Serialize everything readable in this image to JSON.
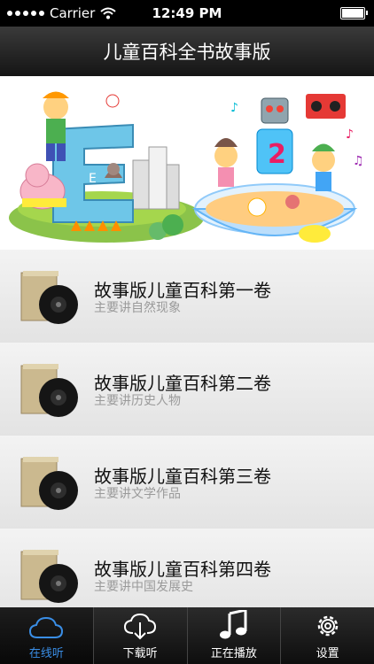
{
  "status_bar": {
    "carrier": "Carrier",
    "time": "12:49 PM"
  },
  "nav": {
    "title": "儿童百科全书故事版"
  },
  "banner": {
    "left_letter": "E",
    "right_numeral": "2"
  },
  "list": [
    {
      "title": "故事版儿童百科第一卷",
      "subtitle": "主要讲自然现象"
    },
    {
      "title": "故事版儿童百科第二卷",
      "subtitle": "主要讲历史人物"
    },
    {
      "title": "故事版儿童百科第三卷",
      "subtitle": "主要讲文学作品"
    },
    {
      "title": "故事版儿童百科第四卷",
      "subtitle": "主要讲中国发展史"
    }
  ],
  "tabs": [
    {
      "label": "在线听",
      "icon": "cloud-icon",
      "active": true
    },
    {
      "label": "下载听",
      "icon": "download-cloud-icon",
      "active": false
    },
    {
      "label": "正在播放",
      "icon": "music-note-icon",
      "active": false
    },
    {
      "label": "设置",
      "icon": "gear-icon",
      "active": false
    }
  ],
  "colors": {
    "accent": "#3a8ee6",
    "navbar": "#1f1f1f"
  }
}
